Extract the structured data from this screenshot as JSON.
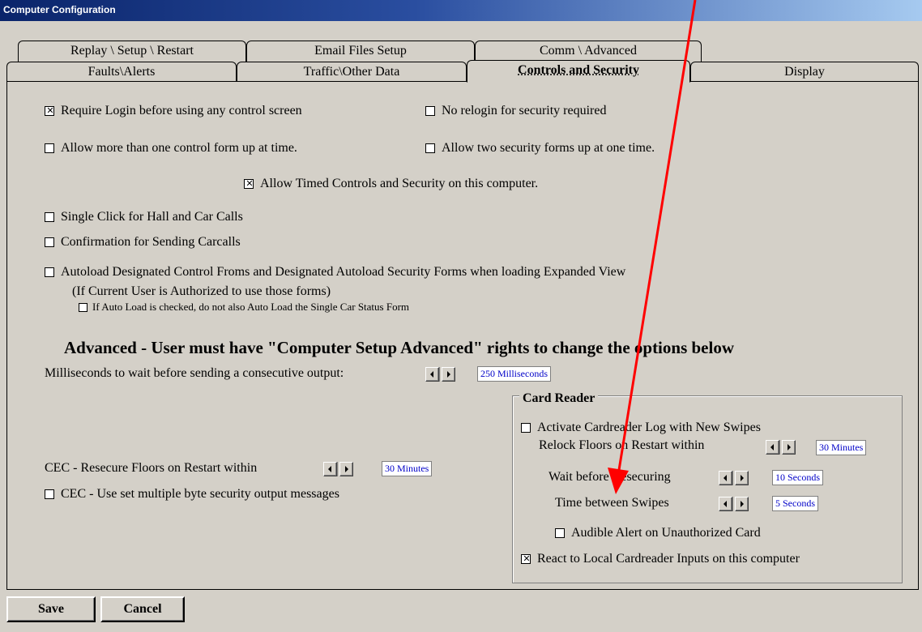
{
  "window": {
    "title": "Computer Configuration"
  },
  "tabs": {
    "row1": [
      "Replay \\ Setup \\ Restart",
      "Email Files Setup",
      "Comm \\ Advanced"
    ],
    "row2": [
      "Faults\\Alerts",
      "Traffic\\Other Data",
      "Controls and Security",
      "Display"
    ],
    "active": "Controls and Security"
  },
  "options": {
    "require_login": {
      "label": "Require Login before using any control screen",
      "checked": true
    },
    "no_relogin": {
      "label": "No relogin for security required",
      "checked": false
    },
    "multi_control_form": {
      "label": "Allow more than one control form up at time.",
      "checked": false
    },
    "two_security_forms": {
      "label": "Allow two security forms up at one time.",
      "checked": false
    },
    "timed_controls": {
      "label": "Allow Timed Controls and Security on this computer.",
      "checked": true
    },
    "single_click": {
      "label": "Single Click for Hall and Car Calls",
      "checked": false
    },
    "confirm_carcalls": {
      "label": "Confirmation for Sending Carcalls",
      "checked": false
    },
    "autoload": {
      "label": "Autoload Designated Control Froms and Designated Autoload Security Forms when loading Expanded View",
      "checked": false
    },
    "autoload_note": "(If Current User is Authorized to use those forms)",
    "no_single_car": {
      "label": "If Auto Load is checked, do not also Auto Load the Single Car Status Form",
      "checked": false
    }
  },
  "advanced": {
    "heading": "Advanced - User must have \"Computer Setup Advanced\" rights to change the options below",
    "ms_wait_label": "Milliseconds to wait before sending a consecutive output:",
    "ms_wait_value": "250 Milliseconds",
    "cec_resecure_label": "CEC - Resecure Floors on Restart within",
    "cec_resecure_value": "30 Minutes",
    "cec_multibyte": {
      "label": "CEC - Use set multiple byte security output  messages",
      "checked": false
    }
  },
  "card_reader": {
    "legend": "Card Reader",
    "activate_log": {
      "label": "Activate Cardreader Log with New Swipes",
      "checked": false
    },
    "relock_label": "Relock Floors on Restart within",
    "relock_value": "30 Minutes",
    "wait_label": "Wait before Resecuring",
    "wait_value": "10 Seconds",
    "between_label": "Time between Swipes",
    "between_value": "5 Seconds",
    "audible_alert": {
      "label": "Audible Alert on Unauthorized Card",
      "checked": false
    },
    "react_local": {
      "label": "React to Local Cardreader Inputs on this computer",
      "checked": true
    }
  },
  "buttons": {
    "save": "Save",
    "cancel": "Cancel"
  },
  "colors": {
    "annotation_arrow": "#ff0000",
    "value_text": "#0000c8"
  }
}
